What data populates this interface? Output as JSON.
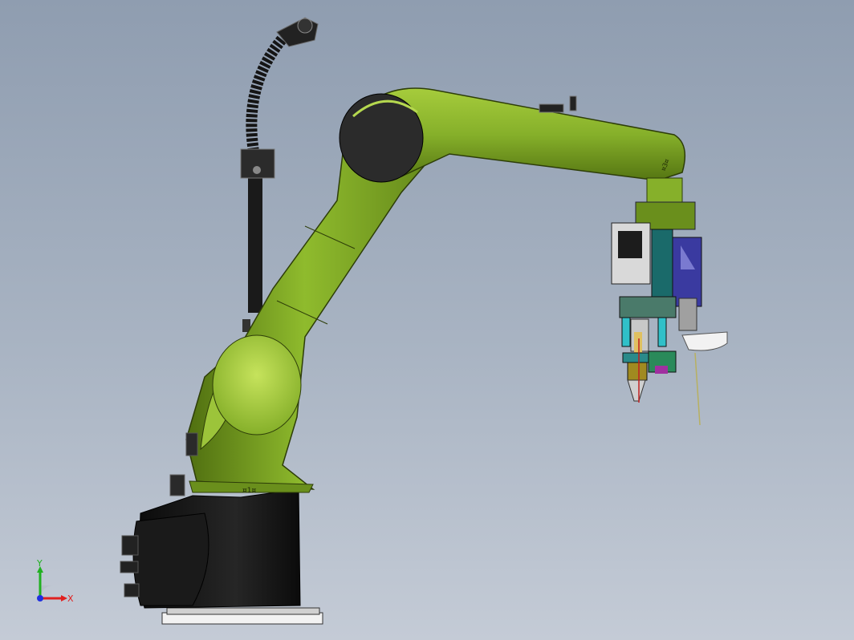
{
  "viewport": {
    "background_top": "#8f9db0",
    "background_bottom": "#c4cbd6"
  },
  "robot": {
    "arm_color": "#86b02a",
    "arm_highlight": "#b5d84f",
    "arm_shadow": "#4f6e10",
    "base_color": "#111111",
    "joint1_label": "¤1¤",
    "forearm_label": "¤3¤"
  },
  "triad": {
    "x_label": "X",
    "y_label": "Y",
    "x_color": "#e02020",
    "y_color": "#20b020",
    "z_color": "#2030e0"
  }
}
